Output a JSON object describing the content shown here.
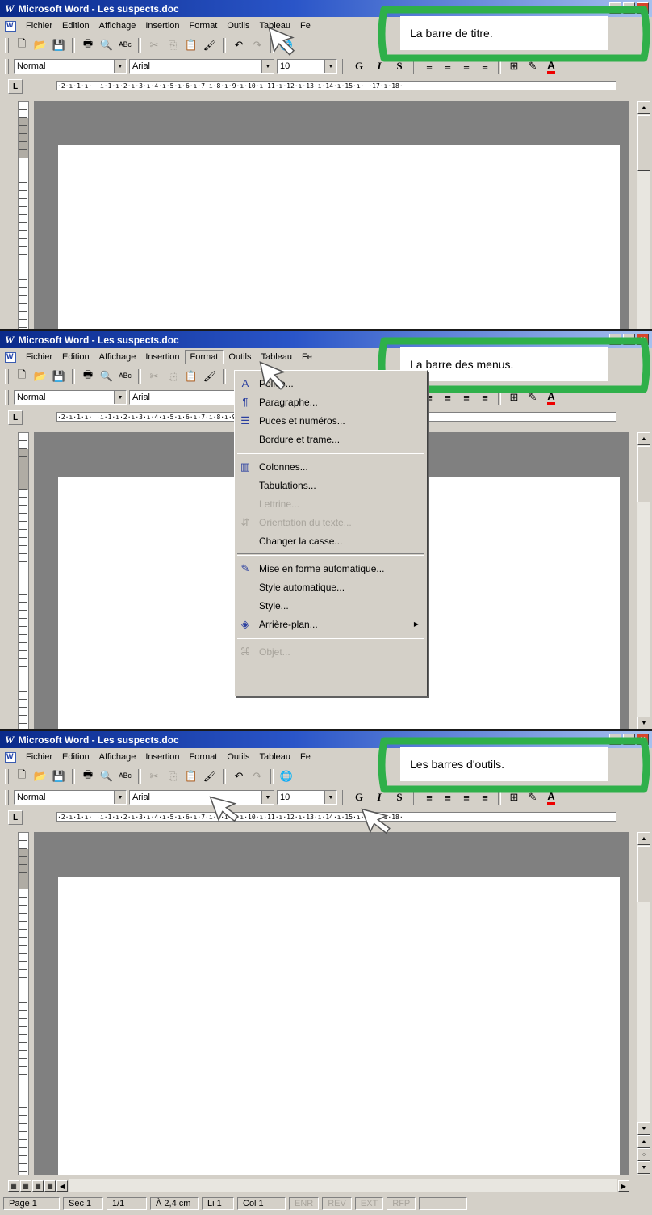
{
  "window": {
    "title": "Microsoft Word - Les suspects.doc",
    "logo": "W"
  },
  "menu": [
    "Fichier",
    "Edition",
    "Affichage",
    "Insertion",
    "Format",
    "Outils",
    "Tableau",
    "Fe"
  ],
  "format_bar": {
    "style": "Normal",
    "font": "Arial",
    "size": "10",
    "bold": "G",
    "italic": "I",
    "underline": "S"
  },
  "ruler": {
    "tab_selector": "L",
    "text": "·2·ı·1·ı·  ·ı·1·ı·2·ı·3·ı·4·ı·5·ı·6·ı·7·ı·8·ı·9·ı·10·ı·11·ı·12·ı·13·ı·14·ı·15·ı·  ·17·ı·18·"
  },
  "callouts": {
    "p1": "La barre de titre.",
    "p2": "La barre des menus.",
    "p3": "Les barres d'outils."
  },
  "format_menu": [
    {
      "label": "Police...",
      "icon": "A",
      "disabled": false
    },
    {
      "label": "Paragraphe...",
      "icon": "¶",
      "disabled": false
    },
    {
      "label": "Puces et numéros...",
      "icon": "☰",
      "disabled": false
    },
    {
      "label": "Bordure et trame...",
      "icon": "",
      "disabled": false
    },
    {
      "sep": true
    },
    {
      "label": "Colonnes...",
      "icon": "▥",
      "disabled": false
    },
    {
      "label": "Tabulations...",
      "icon": "",
      "disabled": false
    },
    {
      "label": "Lettrine...",
      "icon": "",
      "disabled": true
    },
    {
      "label": "Orientation du texte...",
      "icon": "⇵",
      "disabled": true
    },
    {
      "label": "Changer la casse...",
      "icon": "",
      "disabled": false
    },
    {
      "sep": true
    },
    {
      "label": "Mise en forme automatique...",
      "icon": "✎",
      "disabled": false
    },
    {
      "label": "Style automatique...",
      "icon": "",
      "disabled": false
    },
    {
      "label": "Style...",
      "icon": "",
      "disabled": false
    },
    {
      "label": "Arrière-plan...",
      "icon": "◈",
      "disabled": false,
      "submenu": true
    },
    {
      "sep": true
    },
    {
      "label": "Objet...",
      "icon": "⌘",
      "disabled": true
    }
  ],
  "status": {
    "page": "Page 1",
    "sec": "Sec 1",
    "pages": "1/1",
    "at": "À 2,4 cm",
    "line": "Li 1",
    "col": "Col 1",
    "enr": "ENR",
    "rev": "REV",
    "ext": "EXT",
    "rfp": "RFP"
  },
  "icons": {
    "new": "new-document-icon",
    "open": "open-folder-icon",
    "save": "save-icon",
    "print": "print-icon",
    "preview": "print-preview-icon",
    "spell": "spelling-icon",
    "cut": "cut-icon",
    "copy": "copy-icon",
    "paste": "paste-icon",
    "brush": "format-painter-icon",
    "undo": "undo-icon",
    "redo": "redo-icon",
    "web": "hyperlink-icon"
  },
  "colors": {
    "title_start": "#0a2a8a",
    "title_end": "#a6c0ee",
    "callout_green": "#2fb04a",
    "face": "#d4d0c8"
  }
}
